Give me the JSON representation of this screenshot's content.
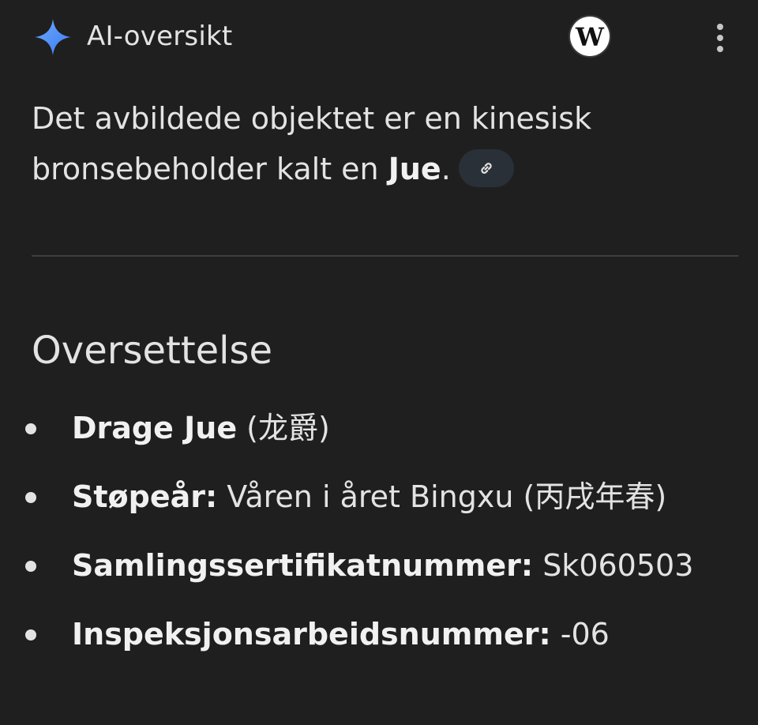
{
  "header": {
    "title": "AI-oversikt",
    "source_badge_letter": "W",
    "sparkle_icon": "sparkle-icon",
    "source_icon": "wikipedia-icon",
    "more_icon": "more-vert-icon"
  },
  "summary": {
    "text_before": "Det avbildede objektet er en kinesisk bronsebeholder kalt en ",
    "emphasis": "Jue",
    "text_after": ".",
    "link_icon": "link-icon"
  },
  "section": {
    "heading": "Oversettelse"
  },
  "items": [
    {
      "label": "Drage Jue",
      "value": " (龙爵)"
    },
    {
      "label": "Støpeår:",
      "value": " Våren i året Bingxu (丙戌年春)"
    },
    {
      "label": "Samlingssertifikatnummer:",
      "value": " Sk060503"
    },
    {
      "label": "Inspeksjonsarbeidsnummer:",
      "value": " -06"
    }
  ],
  "colors": {
    "background": "#1f1f1f",
    "text": "#e3e3e3",
    "sparkle_blue": "#4c8df6",
    "chip_background": "#2a3038",
    "divider": "#3c4043"
  }
}
